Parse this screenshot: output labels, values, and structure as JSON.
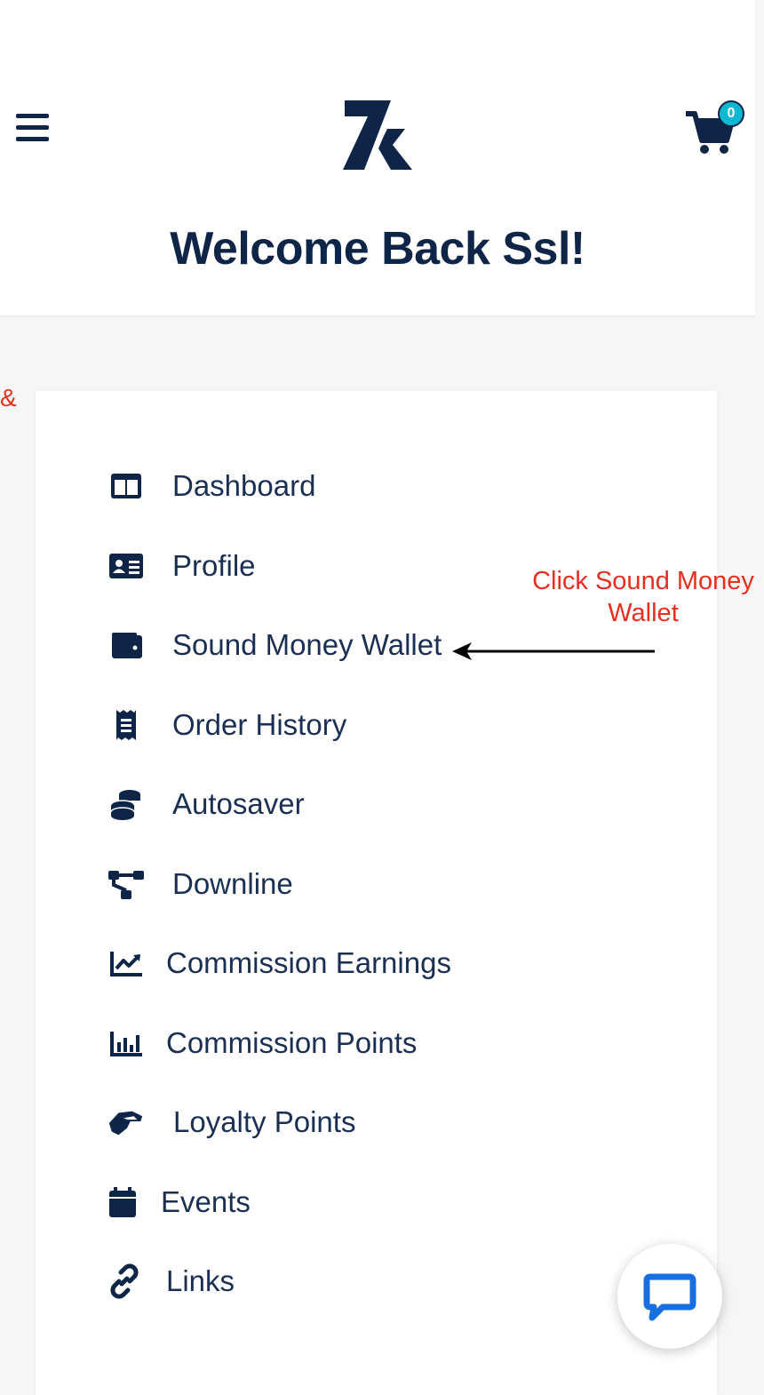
{
  "header": {
    "cart_count": "0",
    "welcome": "Welcome Back Ssl!"
  },
  "edge_text": "&",
  "nav": [
    {
      "label": "Dashboard",
      "icon": "columns-icon"
    },
    {
      "label": "Profile",
      "icon": "id-card-icon"
    },
    {
      "label": "Sound Money Wallet",
      "icon": "wallet-icon"
    },
    {
      "label": "Order History",
      "icon": "receipt-icon"
    },
    {
      "label": "Autosaver",
      "icon": "coins-icon"
    },
    {
      "label": "Downline",
      "icon": "sitemap-icon"
    },
    {
      "label": "Commission Earnings",
      "icon": "chart-line-icon"
    },
    {
      "label": "Commission Points",
      "icon": "chart-bar-icon"
    },
    {
      "label": "Loyalty Points",
      "icon": "handshake-icon"
    },
    {
      "label": "Events",
      "icon": "calendar-icon"
    },
    {
      "label": "Links",
      "icon": "link-icon"
    }
  ],
  "annotation": "Click Sound Money\nWallet",
  "colors": {
    "primary": "#0f2548",
    "badge": "#0fb8d2",
    "annotation": "#e53020",
    "chat": "#1a6fe0"
  }
}
